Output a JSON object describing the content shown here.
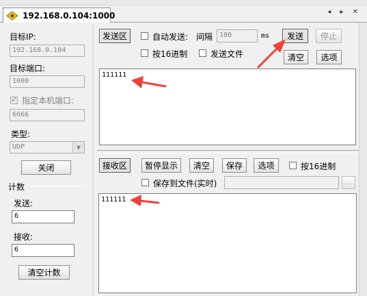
{
  "tab": {
    "title": "192.168.0.104:1000",
    "nav": "◂ ▸ ✕"
  },
  "left": {
    "target_ip_label": "目标IP:",
    "target_ip_value": "192.168.0.104",
    "target_port_label": "目标端口:",
    "target_port_value": "1000",
    "local_port_label": "指定本机端口:",
    "local_port_value": "6666",
    "type_label": "类型:",
    "type_value": "UDP",
    "close_button": "关闭",
    "count_label": "计数",
    "send_label": "发送:",
    "send_value": "6",
    "recv_label": "接收:",
    "recv_value": "6",
    "clear_count_button": "清空计数"
  },
  "send": {
    "area_button": "发送区",
    "auto_send_label": "自动发送:",
    "interval_label": "间隔",
    "interval_value": "100",
    "ms_label": "ms",
    "send_button": "发送",
    "stop_button": "停止",
    "hex_label": "按16进制",
    "send_file_label": "发送文件",
    "clear_button": "清空",
    "options_button": "选项",
    "content": "111111"
  },
  "recv": {
    "area_button": "接收区",
    "pause_button": "暂停显示",
    "clear_button": "清空",
    "save_button": "保存",
    "options_button": "选项",
    "hex_label": "按16进制",
    "save_to_file_label": "保存到文件(实时)",
    "browse_button": "...",
    "content": "111111"
  },
  "colors": {
    "arrow": "#f0413a",
    "accent_icon": "#f5c400"
  }
}
